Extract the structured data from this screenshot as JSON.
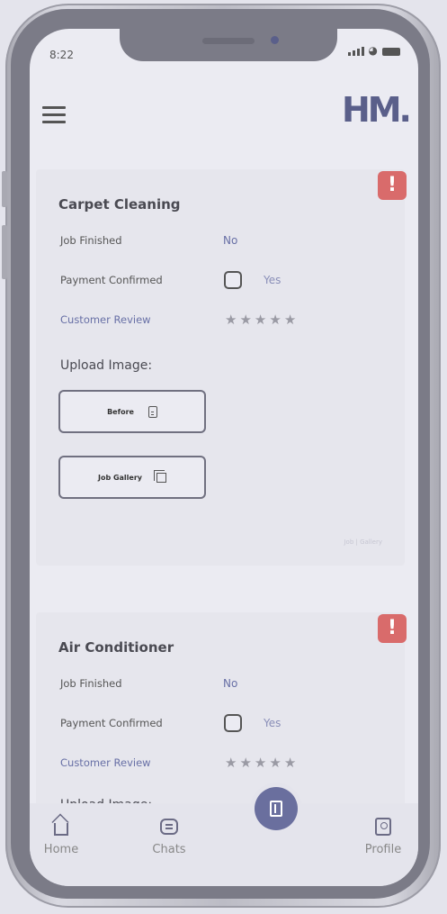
{
  "status_bar": {
    "time": "8:22"
  },
  "header": {
    "logo": "HM."
  },
  "jobs": [
    {
      "title": "Carpet Cleaning",
      "job_finished_label": "Job Finished",
      "job_finished_value": "No",
      "payment_label": "Payment Confirmed",
      "payment_value": "Yes",
      "review_label": "Customer Review",
      "rating": 0,
      "upload_title": "Upload Image:",
      "before_label": "Before",
      "gallery_label": "Job Gallery",
      "footer_link": "Job | Gallery"
    },
    {
      "title": "Air Conditioner",
      "job_finished_label": "Job Finished",
      "job_finished_value": "No",
      "payment_label": "Payment Confirmed",
      "payment_value": "Yes",
      "review_label": "Customer Review",
      "rating": 0,
      "upload_title": "Upload Image:"
    }
  ],
  "bottom_nav": {
    "home": "Home",
    "chats": "Chats",
    "profile": "Profile"
  },
  "alert_glyph": "!",
  "colors": {
    "accent": "#5a5f8a",
    "alert": "#d96b6b",
    "link": "#6870a6"
  }
}
